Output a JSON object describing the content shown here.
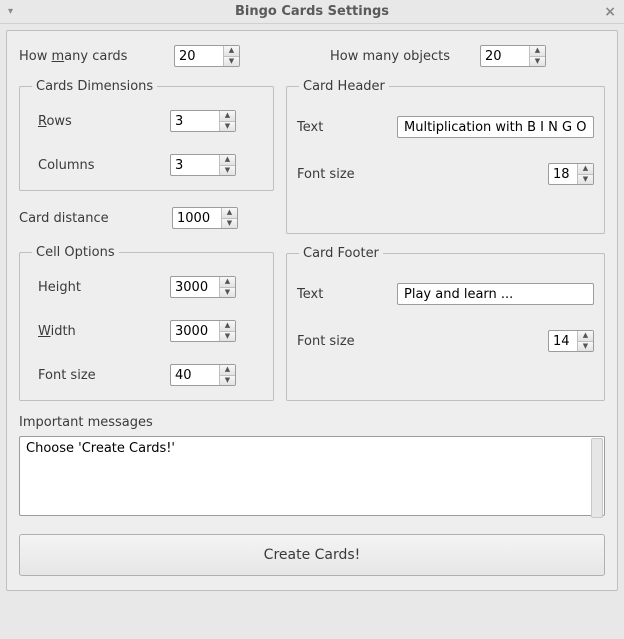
{
  "window": {
    "title": "Bingo Cards Settings"
  },
  "top": {
    "how_many_cards_label_pre": "How ",
    "how_many_cards_label_u": "m",
    "how_many_cards_label_post": "any cards",
    "how_many_cards_value": "20",
    "how_many_objects_label": "How many objects",
    "how_many_objects_value": "20"
  },
  "dimensions": {
    "legend": "Cards Dimensions",
    "rows_label_u": "R",
    "rows_label_post": "ows",
    "rows_value": "3",
    "cols_label": "Columns",
    "cols_value": "3"
  },
  "distance": {
    "label": "Card distance",
    "value": "1000"
  },
  "cell": {
    "legend": "Cell Options",
    "height_label": "Height",
    "height_value": "3000",
    "width_label_u": "W",
    "width_label_post": "idth",
    "width_value": "3000",
    "fontsize_label": "Font size",
    "fontsize_value": "40"
  },
  "header": {
    "legend": "Card Header",
    "text_label": "Text",
    "text_value": "Multiplication with B I N G O!",
    "fontsize_label": "Font size",
    "fontsize_value": "18"
  },
  "footer": {
    "legend": "Card Footer",
    "text_label": "Text",
    "text_value": "Play and learn ...",
    "fontsize_label": "Font size",
    "fontsize_value": "14"
  },
  "messages": {
    "label": "Important messages",
    "value": "Choose 'Create Cards!'"
  },
  "buttons": {
    "create": "Create Cards!"
  }
}
